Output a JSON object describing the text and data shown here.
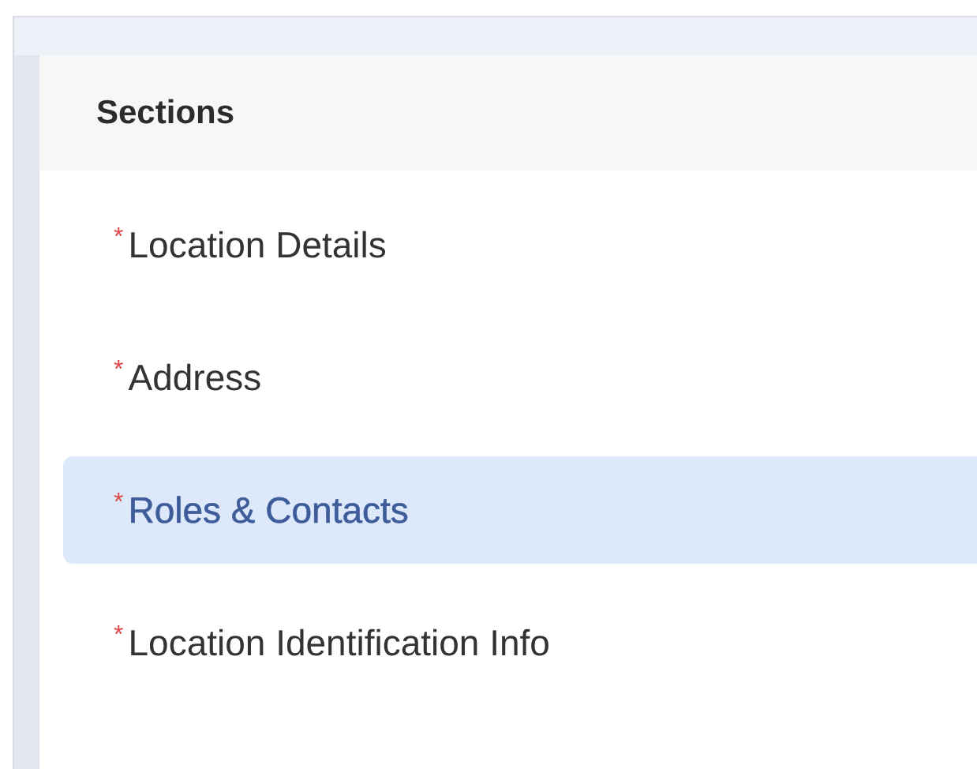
{
  "panel": {
    "title": "Sections"
  },
  "sections": [
    {
      "marker": "*",
      "label": "Location Details",
      "selected": false
    },
    {
      "marker": "*",
      "label": "Address",
      "selected": false
    },
    {
      "marker": "*",
      "label": "Roles & Contacts",
      "selected": true
    },
    {
      "marker": "*",
      "label": "Location Identification Info",
      "selected": false
    }
  ]
}
